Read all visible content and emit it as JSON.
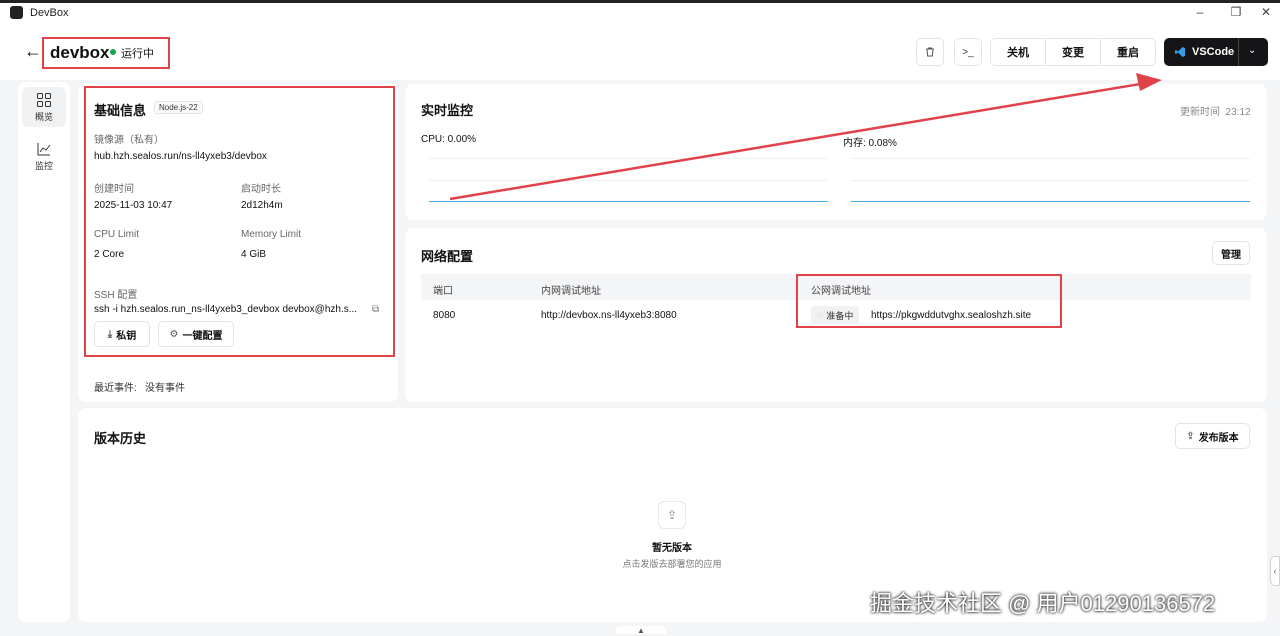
{
  "window": {
    "title": "DevBox"
  },
  "header": {
    "name": "devbox",
    "status": "运行中",
    "buttons": [
      "关机",
      "变更",
      "重启"
    ],
    "terminal_label": ">_",
    "vscode_label": "VSCode"
  },
  "sidebar": {
    "items": [
      {
        "label": "概览",
        "icon": "grid-icon",
        "active": true
      },
      {
        "label": "监控",
        "icon": "line-chart-icon",
        "active": false
      }
    ]
  },
  "basic_info": {
    "title": "基础信息",
    "runtime_tag": "Node.js-22",
    "image_label": "镜像源（私有）",
    "image_value": "hub.hzh.sealos.run/ns-ll4yxeb3/devbox",
    "created_label": "创建时间",
    "created_value": "2025-11-03 10:47",
    "uptime_label": "启动时长",
    "uptime_value": "2d12h4m",
    "cpu_limit_label": "CPU Limit",
    "cpu_limit_value": "2 Core",
    "mem_limit_label": "Memory Limit",
    "mem_limit_value": "4 GiB",
    "ssh_label": "SSH 配置",
    "ssh_value": "ssh -i hzh.sealos.run_ns-ll4yxeb3_devbox devbox@hzh.s...",
    "private_key_btn": "私钥",
    "one_click_btn": "一键配置",
    "recent_events_label": "最近事件:",
    "recent_events_value": "没有事件"
  },
  "monitor": {
    "title": "实时监控",
    "updated": "更新时间  23:12",
    "cpu": "CPU: 0.00%",
    "memory": "内存: 0.08%"
  },
  "network": {
    "title": "网络配置",
    "manage_btn": "管理",
    "columns": [
      "端口",
      "内网调试地址",
      "公网调试地址"
    ],
    "rows": [
      {
        "port": "8080",
        "internal": "http://devbox.ns-ll4yxeb3:8080",
        "public_status": "准备中",
        "public": "https://pkgwddutvghx.sealoshzh.site"
      }
    ]
  },
  "versions": {
    "title": "版本历史",
    "publish_btn": "发布版本",
    "empty_title": "暂无版本",
    "empty_desc": "点击发版去部署您的应用"
  },
  "watermark": "掘金技术社区 @ 用户01290136572",
  "colors": {
    "annotation": "#e0424a",
    "status": "#16a34a",
    "chart": "#4aa8e0"
  }
}
